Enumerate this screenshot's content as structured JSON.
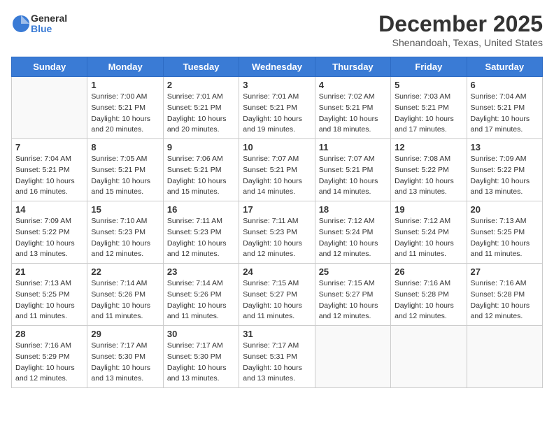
{
  "logo": {
    "text_general": "General",
    "text_blue": "Blue"
  },
  "title": "December 2025",
  "subtitle": "Shenandoah, Texas, United States",
  "days_of_week": [
    "Sunday",
    "Monday",
    "Tuesday",
    "Wednesday",
    "Thursday",
    "Friday",
    "Saturday"
  ],
  "weeks": [
    [
      {
        "day": "",
        "info": ""
      },
      {
        "day": "1",
        "info": "Sunrise: 7:00 AM\nSunset: 5:21 PM\nDaylight: 10 hours\nand 20 minutes."
      },
      {
        "day": "2",
        "info": "Sunrise: 7:01 AM\nSunset: 5:21 PM\nDaylight: 10 hours\nand 20 minutes."
      },
      {
        "day": "3",
        "info": "Sunrise: 7:01 AM\nSunset: 5:21 PM\nDaylight: 10 hours\nand 19 minutes."
      },
      {
        "day": "4",
        "info": "Sunrise: 7:02 AM\nSunset: 5:21 PM\nDaylight: 10 hours\nand 18 minutes."
      },
      {
        "day": "5",
        "info": "Sunrise: 7:03 AM\nSunset: 5:21 PM\nDaylight: 10 hours\nand 17 minutes."
      },
      {
        "day": "6",
        "info": "Sunrise: 7:04 AM\nSunset: 5:21 PM\nDaylight: 10 hours\nand 17 minutes."
      }
    ],
    [
      {
        "day": "7",
        "info": "Sunrise: 7:04 AM\nSunset: 5:21 PM\nDaylight: 10 hours\nand 16 minutes."
      },
      {
        "day": "8",
        "info": "Sunrise: 7:05 AM\nSunset: 5:21 PM\nDaylight: 10 hours\nand 15 minutes."
      },
      {
        "day": "9",
        "info": "Sunrise: 7:06 AM\nSunset: 5:21 PM\nDaylight: 10 hours\nand 15 minutes."
      },
      {
        "day": "10",
        "info": "Sunrise: 7:07 AM\nSunset: 5:21 PM\nDaylight: 10 hours\nand 14 minutes."
      },
      {
        "day": "11",
        "info": "Sunrise: 7:07 AM\nSunset: 5:21 PM\nDaylight: 10 hours\nand 14 minutes."
      },
      {
        "day": "12",
        "info": "Sunrise: 7:08 AM\nSunset: 5:22 PM\nDaylight: 10 hours\nand 13 minutes."
      },
      {
        "day": "13",
        "info": "Sunrise: 7:09 AM\nSunset: 5:22 PM\nDaylight: 10 hours\nand 13 minutes."
      }
    ],
    [
      {
        "day": "14",
        "info": "Sunrise: 7:09 AM\nSunset: 5:22 PM\nDaylight: 10 hours\nand 13 minutes."
      },
      {
        "day": "15",
        "info": "Sunrise: 7:10 AM\nSunset: 5:23 PM\nDaylight: 10 hours\nand 12 minutes."
      },
      {
        "day": "16",
        "info": "Sunrise: 7:11 AM\nSunset: 5:23 PM\nDaylight: 10 hours\nand 12 minutes."
      },
      {
        "day": "17",
        "info": "Sunrise: 7:11 AM\nSunset: 5:23 PM\nDaylight: 10 hours\nand 12 minutes."
      },
      {
        "day": "18",
        "info": "Sunrise: 7:12 AM\nSunset: 5:24 PM\nDaylight: 10 hours\nand 12 minutes."
      },
      {
        "day": "19",
        "info": "Sunrise: 7:12 AM\nSunset: 5:24 PM\nDaylight: 10 hours\nand 11 minutes."
      },
      {
        "day": "20",
        "info": "Sunrise: 7:13 AM\nSunset: 5:25 PM\nDaylight: 10 hours\nand 11 minutes."
      }
    ],
    [
      {
        "day": "21",
        "info": "Sunrise: 7:13 AM\nSunset: 5:25 PM\nDaylight: 10 hours\nand 11 minutes."
      },
      {
        "day": "22",
        "info": "Sunrise: 7:14 AM\nSunset: 5:26 PM\nDaylight: 10 hours\nand 11 minutes."
      },
      {
        "day": "23",
        "info": "Sunrise: 7:14 AM\nSunset: 5:26 PM\nDaylight: 10 hours\nand 11 minutes."
      },
      {
        "day": "24",
        "info": "Sunrise: 7:15 AM\nSunset: 5:27 PM\nDaylight: 10 hours\nand 11 minutes."
      },
      {
        "day": "25",
        "info": "Sunrise: 7:15 AM\nSunset: 5:27 PM\nDaylight: 10 hours\nand 12 minutes."
      },
      {
        "day": "26",
        "info": "Sunrise: 7:16 AM\nSunset: 5:28 PM\nDaylight: 10 hours\nand 12 minutes."
      },
      {
        "day": "27",
        "info": "Sunrise: 7:16 AM\nSunset: 5:28 PM\nDaylight: 10 hours\nand 12 minutes."
      }
    ],
    [
      {
        "day": "28",
        "info": "Sunrise: 7:16 AM\nSunset: 5:29 PM\nDaylight: 10 hours\nand 12 minutes."
      },
      {
        "day": "29",
        "info": "Sunrise: 7:17 AM\nSunset: 5:30 PM\nDaylight: 10 hours\nand 13 minutes."
      },
      {
        "day": "30",
        "info": "Sunrise: 7:17 AM\nSunset: 5:30 PM\nDaylight: 10 hours\nand 13 minutes."
      },
      {
        "day": "31",
        "info": "Sunrise: 7:17 AM\nSunset: 5:31 PM\nDaylight: 10 hours\nand 13 minutes."
      },
      {
        "day": "",
        "info": ""
      },
      {
        "day": "",
        "info": ""
      },
      {
        "day": "",
        "info": ""
      }
    ]
  ]
}
